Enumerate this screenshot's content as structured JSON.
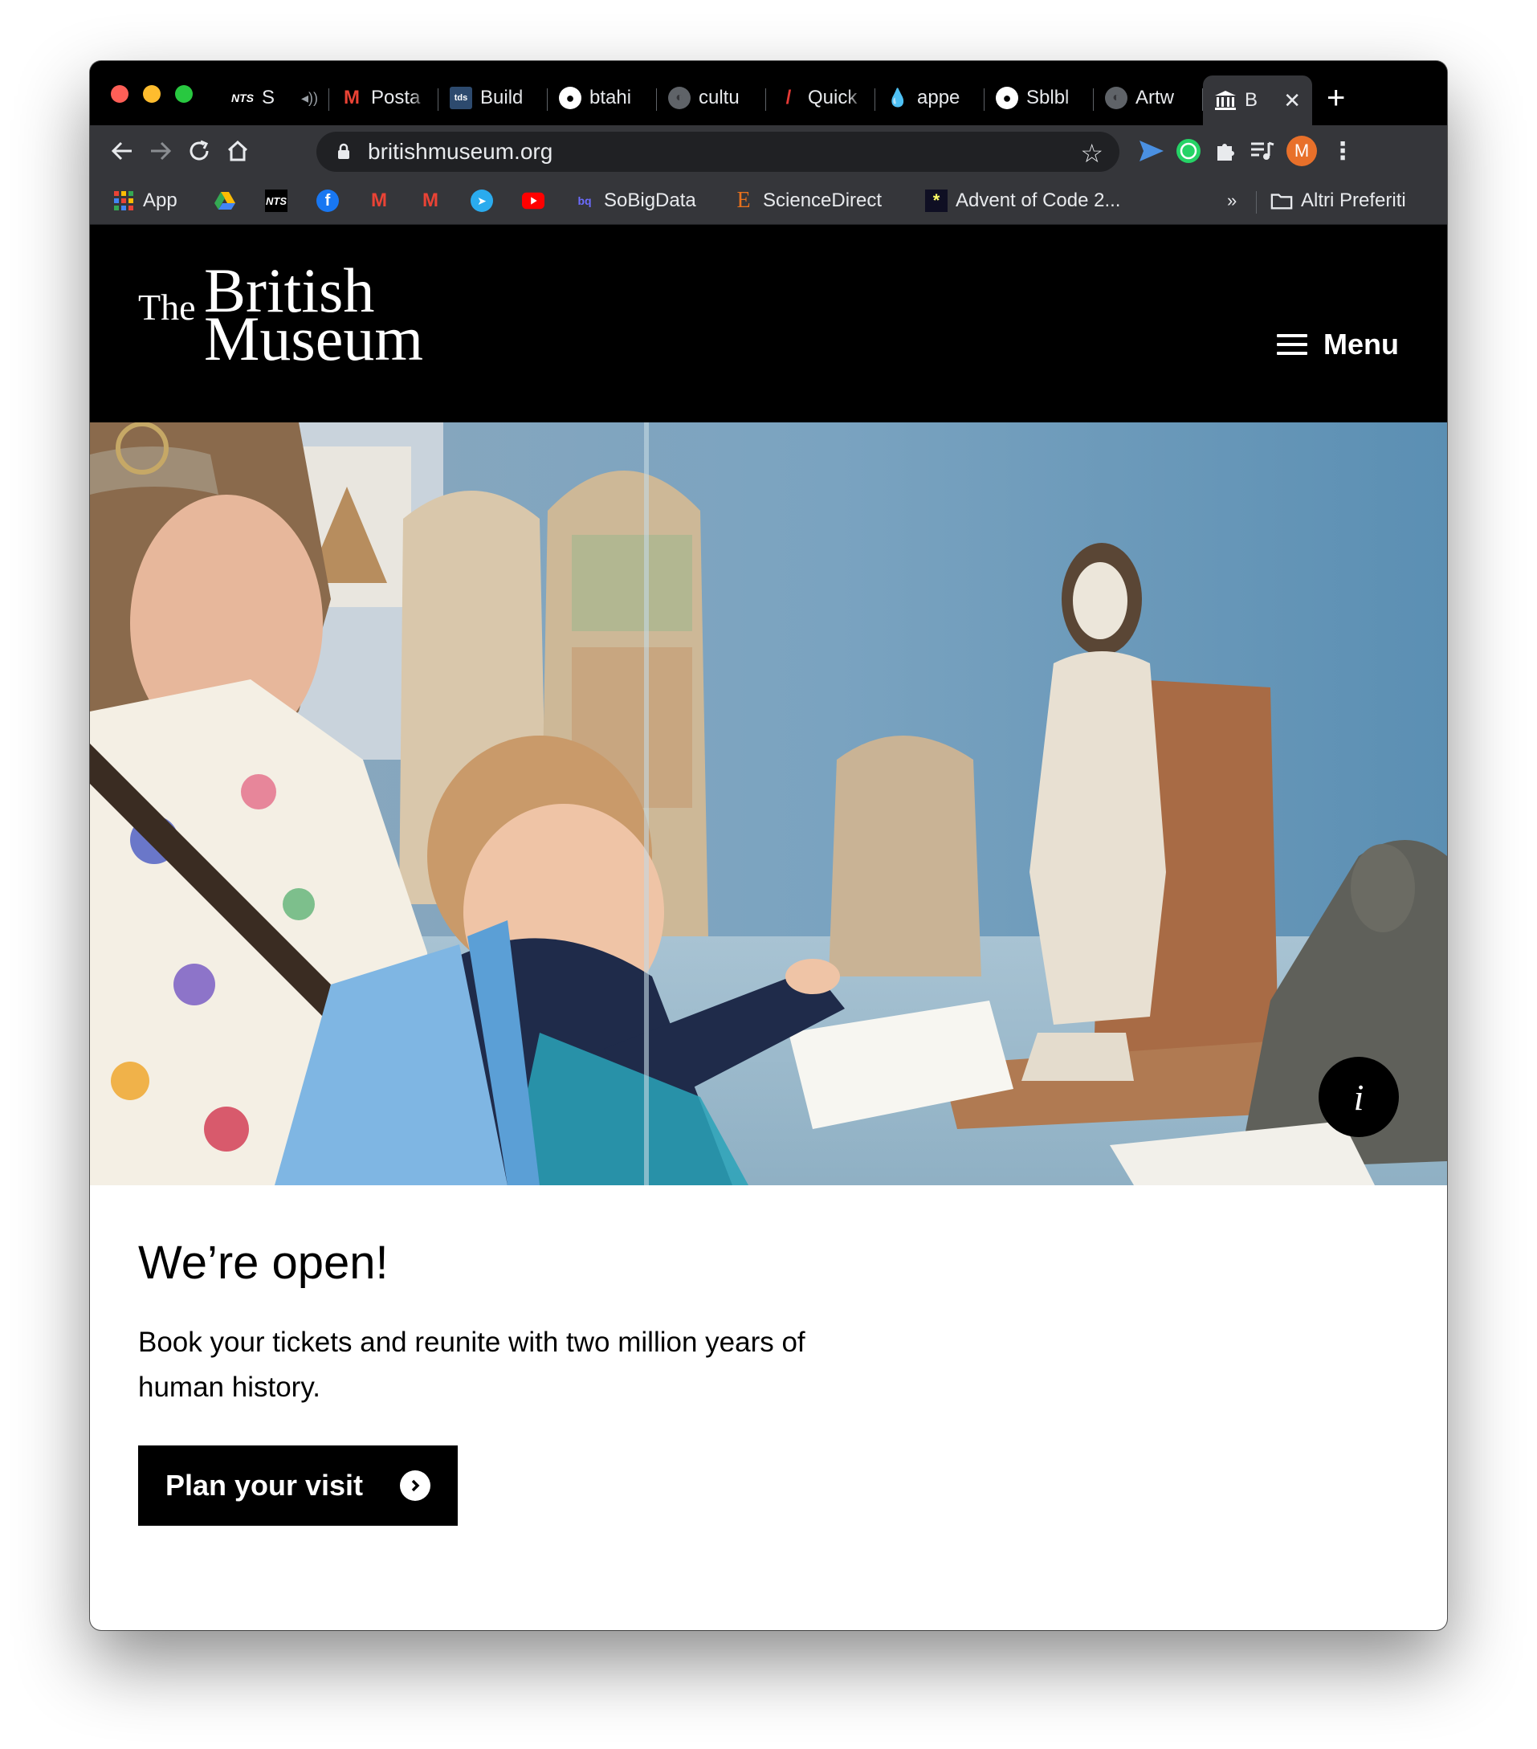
{
  "browser": {
    "tabs": [
      {
        "title": "S",
        "icon": "nts-icon"
      },
      {
        "title": "Posta",
        "icon": "gmail-icon"
      },
      {
        "title": "Build",
        "icon": "tds-icon"
      },
      {
        "title": "btahi",
        "icon": "github-icon"
      },
      {
        "title": "cultu",
        "icon": "globe-icon"
      },
      {
        "title": "Quick",
        "icon": "pen-icon"
      },
      {
        "title": "appe",
        "icon": "drop-icon"
      },
      {
        "title": "Sblbl",
        "icon": "github-icon"
      },
      {
        "title": "Artw",
        "icon": "globe-icon"
      },
      {
        "title": "B",
        "icon": "museum-icon",
        "active": true
      }
    ],
    "url": "britishmuseum.org",
    "profile_initial": "M",
    "bookmarks": {
      "app": "App",
      "sobigdata": "SoBigData",
      "sciencedirect": "ScienceDirect",
      "advent": "Advent of Code 2...",
      "overflow": "»",
      "other": "Altri Preferiti"
    }
  },
  "site": {
    "logo": {
      "the": "The",
      "british": "British",
      "museum": "Museum"
    },
    "menu_label": "Menu",
    "info_label": "i",
    "headline": "We’re open!",
    "lead": "Book your tickets and reunite with two million years of human history.",
    "cta_label": "Plan your visit"
  },
  "colors": {
    "header_bg": "#000000",
    "cta_bg": "#000000",
    "profile_bg": "#e8702a"
  }
}
